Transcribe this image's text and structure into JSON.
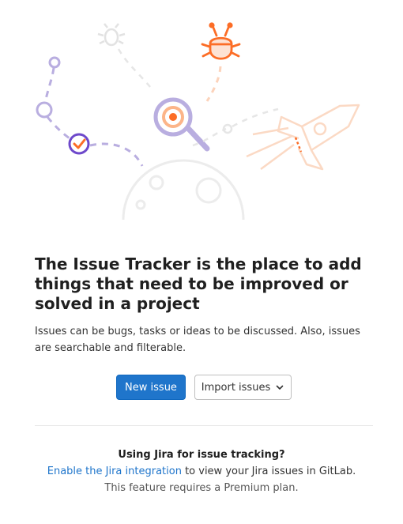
{
  "empty_state": {
    "title": "The Issue Tracker is the place to add things that need to be improved or solved in a project",
    "description": "Issues can be bugs, tasks or ideas to be discussed. Also, issues are searchable and filterable."
  },
  "actions": {
    "new_issue_label": "New issue",
    "import_issues_label": "Import issues"
  },
  "jira": {
    "heading": "Using Jira for issue tracking?",
    "link_text": "Enable the Jira integration",
    "link_suffix": " to view your Jira issues in GitLab.",
    "premium_note": "This feature requires a Premium plan."
  },
  "colors": {
    "primary": "#1f75cb",
    "illustration_purple": "#6e49cb",
    "illustration_orange": "#fc6d26"
  },
  "icons": {
    "illustration": "issues-empty-state-illustration",
    "dropdown": "chevron-down-icon"
  }
}
